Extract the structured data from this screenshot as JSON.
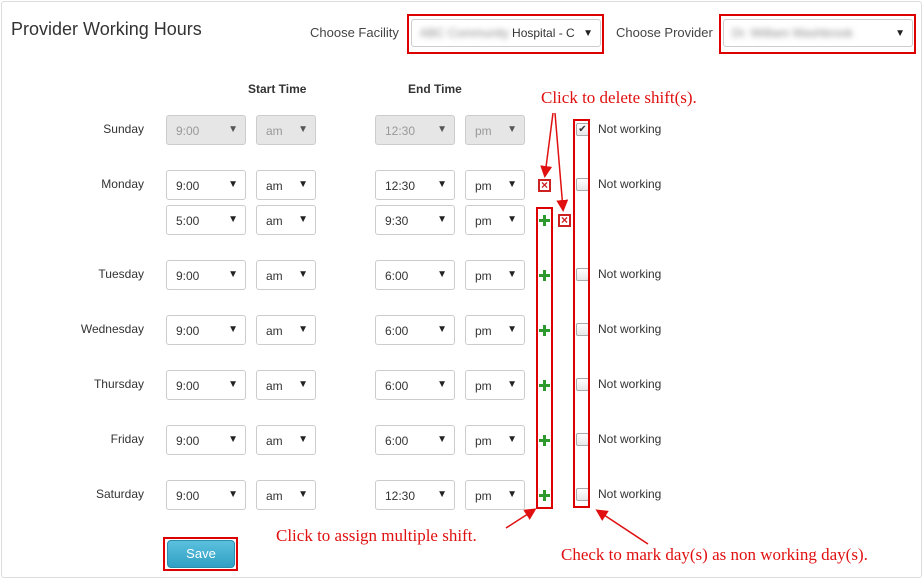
{
  "page_title": "Provider Working Hours",
  "facility": {
    "label": "Choose Facility",
    "value_blurred": "ABC Community",
    "value": "Hospital - C"
  },
  "provider": {
    "label": "Choose Provider",
    "value_blurred": "Dr. William Washbrook"
  },
  "columns": {
    "start": "Start Time",
    "end": "End Time"
  },
  "not_working_label": "Not working",
  "days": [
    {
      "name": "Sunday",
      "start": "9:00",
      "start_ampm": "am",
      "end": "12:30",
      "end_ampm": "pm",
      "not_working": true
    },
    {
      "name": "Monday",
      "start": "9:00",
      "start_ampm": "am",
      "end": "12:30",
      "end_ampm": "pm",
      "not_working": false
    },
    {
      "name": "",
      "start": "5:00",
      "start_ampm": "am",
      "end": "9:30",
      "end_ampm": "pm"
    },
    {
      "name": "Tuesday",
      "start": "9:00",
      "start_ampm": "am",
      "end": "6:00",
      "end_ampm": "pm",
      "not_working": false
    },
    {
      "name": "Wednesday",
      "start": "9:00",
      "start_ampm": "am",
      "end": "6:00",
      "end_ampm": "pm",
      "not_working": false
    },
    {
      "name": "Thursday",
      "start": "9:00",
      "start_ampm": "am",
      "end": "6:00",
      "end_ampm": "pm",
      "not_working": false
    },
    {
      "name": "Friday",
      "start": "9:00",
      "start_ampm": "am",
      "end": "6:00",
      "end_ampm": "pm",
      "not_working": false
    },
    {
      "name": "Saturday",
      "start": "9:00",
      "start_ampm": "am",
      "end": "12:30",
      "end_ampm": "pm",
      "not_working": false
    }
  ],
  "notes": {
    "delete": "Click to delete shift(s).",
    "assign": "Click to assign multiple shift.",
    "check": "Check to mark day(s) as non working day(s)."
  },
  "save_label": "Save",
  "colors": {
    "annotation": "#e01010",
    "add": "#2e9a2e",
    "save": "#5bc0de"
  }
}
